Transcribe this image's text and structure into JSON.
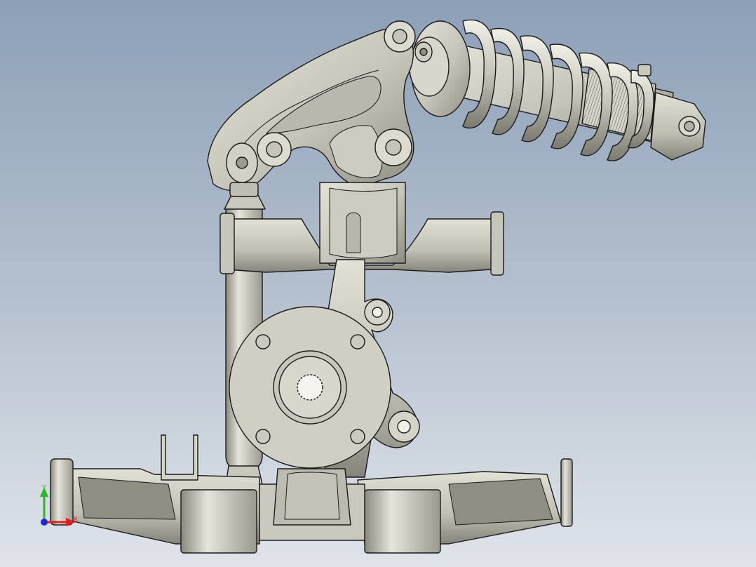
{
  "viewport": {
    "background_top": "#8da0b8",
    "background_bottom": "#dfe4ea",
    "part_color": "#d2d1c6",
    "part_shadow": "#8f8e82",
    "edge_color": "#1a1a1a"
  },
  "triad": {
    "x_label": "X",
    "y_label": "Y",
    "x_color": "#e0201e",
    "y_color": "#2fb52a",
    "origin_color": "#1f2bd6"
  },
  "model": {
    "components": [
      "rocker-arm",
      "coilover-shock",
      "pushrod",
      "upper-wishbone",
      "upright",
      "wheel-hub",
      "lower-wishbone"
    ]
  }
}
